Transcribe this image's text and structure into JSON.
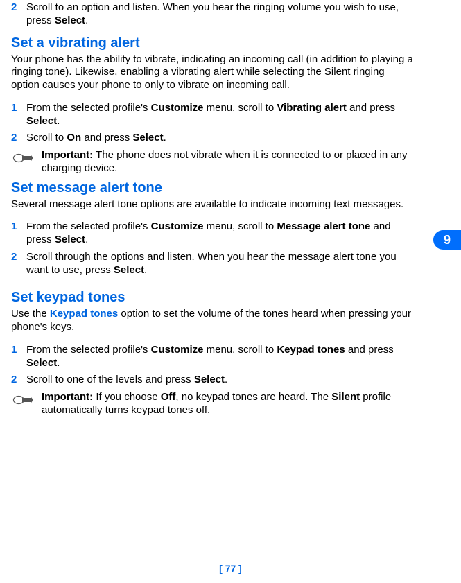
{
  "ringing": {
    "step2_num": "2",
    "step2_a": "Scroll to an option and listen. When you hear the ringing volume you wish to use, press ",
    "step2_b": "Select",
    "step2_c": "."
  },
  "vibrating": {
    "heading": "Set a vibrating alert",
    "intro": "Your phone has the ability to vibrate, indicating an incoming call (in addition to playing a ringing tone). Likewise, enabling a vibrating alert while selecting the Silent ringing option causes your phone to only to vibrate on incoming call.",
    "step1_num": "1",
    "step1_a": "From the selected profile's ",
    "step1_b": "Customize",
    "step1_c": " menu, scroll to ",
    "step1_d": "Vibrating alert",
    "step1_e": " and press ",
    "step1_f": "Select",
    "step1_g": ".",
    "step2_num": "2",
    "step2_a": "Scroll to ",
    "step2_b": "On",
    "step2_c": " and press ",
    "step2_d": "Select",
    "step2_e": ".",
    "note_label": "Important:",
    "note_text": " The phone does not vibrate when it is connected to or placed in any charging device."
  },
  "message": {
    "heading": "Set message alert tone",
    "intro": "Several message alert tone options are available to indicate incoming text messages.",
    "step1_num": "1",
    "step1_a": "From the selected profile's ",
    "step1_b": "Customize",
    "step1_c": " menu, scroll to ",
    "step1_d": "Message alert tone",
    "step1_e": " and press ",
    "step1_f": "Select",
    "step1_g": ".",
    "step2_num": "2",
    "step2_a": "Scroll through the options and listen. When you hear the message alert tone you want to use, press ",
    "step2_b": "Select",
    "step2_c": "."
  },
  "keypad": {
    "heading": "Set keypad tones",
    "intro_a": "Use the ",
    "intro_b": "Keypad tones",
    "intro_c": " option to set the volume of the tones heard when pressing your phone's keys.",
    "step1_num": "1",
    "step1_a": "From the selected profile's ",
    "step1_b": "Customize",
    "step1_c": " menu, scroll to ",
    "step1_d": "Keypad tones",
    "step1_e": " and press ",
    "step1_f": "Select",
    "step1_g": ".",
    "step2_num": "2",
    "step2_a": "Scroll to one of the levels and press ",
    "step2_b": "Select",
    "step2_c": ".",
    "note_label": "Important:",
    "note_a": " If you choose ",
    "note_b": "Off",
    "note_c": ", no keypad tones are heard. The ",
    "note_d": "Silent",
    "note_e": " profile automatically turns keypad tones off."
  },
  "tab": "9",
  "page_number": "[ 77 ]"
}
